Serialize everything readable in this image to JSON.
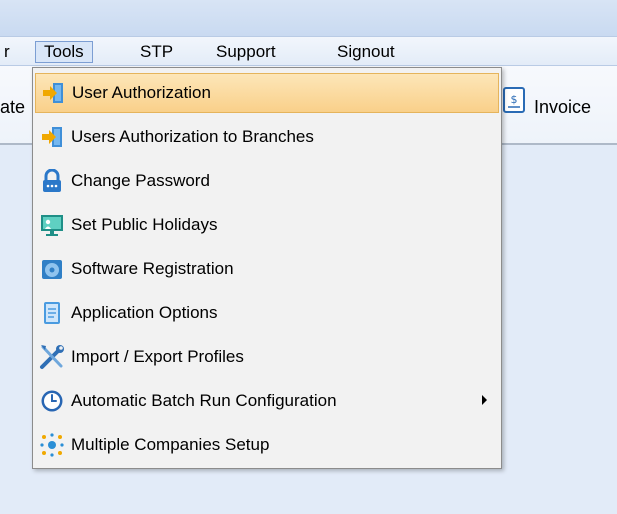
{
  "menubar": {
    "items": [
      {
        "label": "r"
      },
      {
        "label": "Tools",
        "active": true
      },
      {
        "label": "STP"
      },
      {
        "label": "Support"
      },
      {
        "label": "Signout"
      }
    ]
  },
  "toolbar": {
    "left_label_fragment": "ate",
    "invoice_label": "Invoice",
    "invoice_icon": "invoice-document-icon"
  },
  "tools_menu": {
    "items": [
      {
        "label": "User Authorization",
        "icon": "user-authorization-icon",
        "highlighted": true
      },
      {
        "label": "Users Authorization to Branches",
        "icon": "user-branches-icon"
      },
      {
        "label": "Change Password",
        "icon": "lock-icon"
      },
      {
        "label": "Set Public Holidays",
        "icon": "calendar-presentation-icon"
      },
      {
        "label": "Software Registration",
        "icon": "registration-disc-icon"
      },
      {
        "label": "Application Options",
        "icon": "document-options-icon"
      },
      {
        "label": "Import / Export Profiles",
        "icon": "tools-wrench-screwdriver-icon"
      },
      {
        "label": "Automatic Batch Run Configuration",
        "icon": "clock-icon",
        "has_submenu": true
      },
      {
        "label": "Multiple Companies Setup",
        "icon": "network-nodes-icon"
      }
    ]
  },
  "colors": {
    "highlight_top": "#fde6b8",
    "highlight_bottom": "#f9d08a",
    "menubar_active_border": "#7c9ed3",
    "background": "#e2ebf8"
  }
}
